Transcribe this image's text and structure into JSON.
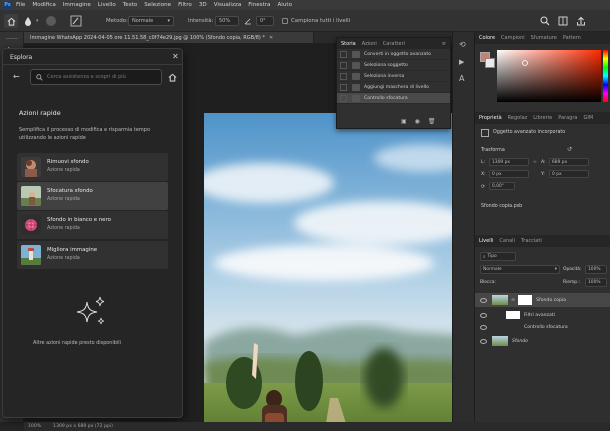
{
  "menubar": {
    "logo": "Ps",
    "items": [
      "File",
      "Modifica",
      "Immagine",
      "Livello",
      "Testo",
      "Selezione",
      "Filtro",
      "3D",
      "Visualizza",
      "Finestra",
      "Aiuto"
    ]
  },
  "options_bar": {
    "mode_label": "Metodo:",
    "mode_value": "Normale",
    "intensity_label": "Intensità:",
    "intensity_value": "50%",
    "angle_value": "0°",
    "sample_all_label": "Campiona tutti i livelli"
  },
  "document_tab": {
    "title": "Immagine WhatsApp 2024-04-05 ore 11.51.58_c0f74e29.jpg @ 100% (Sfondo copia, RGB/8) *"
  },
  "history_panel": {
    "tabs": [
      "Storia",
      "Azioni",
      "Caratteri"
    ],
    "items": [
      "Converti in oggetto avanzato",
      "Seleziona soggetto",
      "Seleziona inversa",
      "Aggiungi maschera di livello",
      "Controllo sfocatura"
    ]
  },
  "explore_panel": {
    "title": "Esplora",
    "search_placeholder": "Cerca assistenza e scopri di più",
    "section_title": "Azioni rapide",
    "description": "Semplifica il processo di modifica e risparmia tempo utilizzando le azioni rapide",
    "items": [
      {
        "name": "Rimuovi sfondo",
        "sub": "Azione rapida"
      },
      {
        "name": "Sfocatura sfondo",
        "sub": "Azione rapida"
      },
      {
        "name": "Sfondo in bianco e nero",
        "sub": "Azione rapida"
      },
      {
        "name": "Migliora immagine",
        "sub": "Azione rapida"
      }
    ],
    "footer": "Altre azioni rapide presto disponibili"
  },
  "color_panel": {
    "tabs": [
      "Colore",
      "Campioni",
      "Sfumature",
      "Pattern"
    ],
    "hue_color": "#ff2a00"
  },
  "properties_panel": {
    "tabs": [
      "Proprietà",
      "Regolaz",
      "Librerie",
      "Paragra",
      "GIM"
    ],
    "object_label": "Oggetto avanzato incorporato",
    "transform_label": "Trasforma",
    "L_label": "L:",
    "L_value": "1309 px",
    "A_label": "A:",
    "A_value": "689 px",
    "X_label": "X:",
    "X_value": "0 px",
    "Y_label": "Y:",
    "Y_value": "0 px",
    "angle_value": "0,00°",
    "file_name": "Sfondo copia.psb"
  },
  "layers_panel": {
    "tabs": [
      "Livelli",
      "Canali",
      "Tracciati"
    ],
    "filter_label": "Tipo",
    "blend_mode": "Normale",
    "opacity_label": "Opacità:",
    "opacity_value": "100%",
    "lock_label": "Blocca:",
    "fill_label": "Riemp.:",
    "fill_value": "100%",
    "layers": [
      {
        "name": "Sfondo copia"
      },
      {
        "name": "Filtri avanzati"
      },
      {
        "name": "Controllo sfocatura"
      },
      {
        "name": "Sfondo"
      }
    ]
  },
  "status_bar": {
    "zoom": "100%",
    "dims": "1309 px x 689 px (72 ppi)"
  }
}
